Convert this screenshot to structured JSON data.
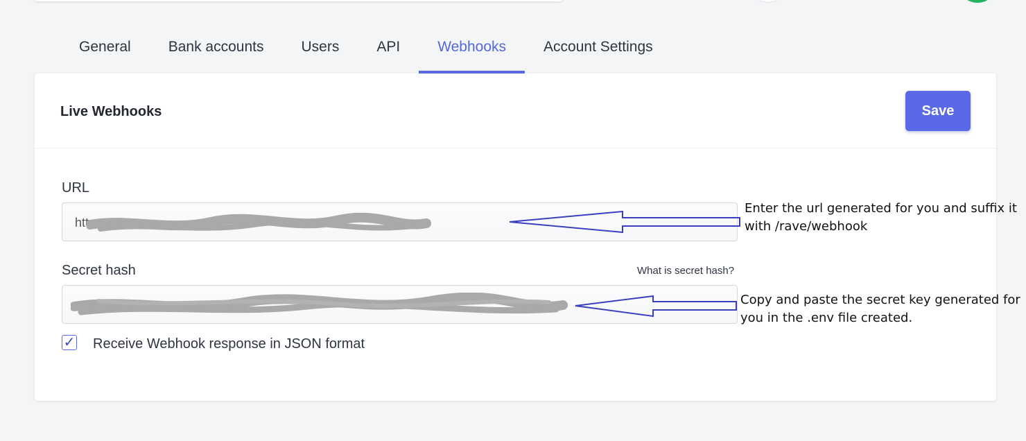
{
  "tabs": [
    {
      "label": "General",
      "active": false
    },
    {
      "label": "Bank accounts",
      "active": false
    },
    {
      "label": "Users",
      "active": false
    },
    {
      "label": "API",
      "active": false
    },
    {
      "label": "Webhooks",
      "active": true
    },
    {
      "label": "Account Settings",
      "active": false
    }
  ],
  "card": {
    "title": "Live Webhooks",
    "save_label": "Save"
  },
  "url_field": {
    "label": "URL",
    "value": "http"
  },
  "secret_field": {
    "label": "Secret hash",
    "help_link": "What is secret hash?",
    "value": ""
  },
  "json_checkbox": {
    "checked": true,
    "label": "Receive Webhook response in JSON format"
  },
  "annotations": {
    "url_note_line1": "Enter the url generated for you and suffix it",
    "url_note_line2": "with /rave/webhook",
    "secret_note_line1": "Copy and paste the secret key generated for",
    "secret_note_line2": "you in the .env file created."
  },
  "colors": {
    "accent": "#5a6ae6",
    "arrow": "#3a3fc0",
    "redaction": "#a9a9a9"
  }
}
